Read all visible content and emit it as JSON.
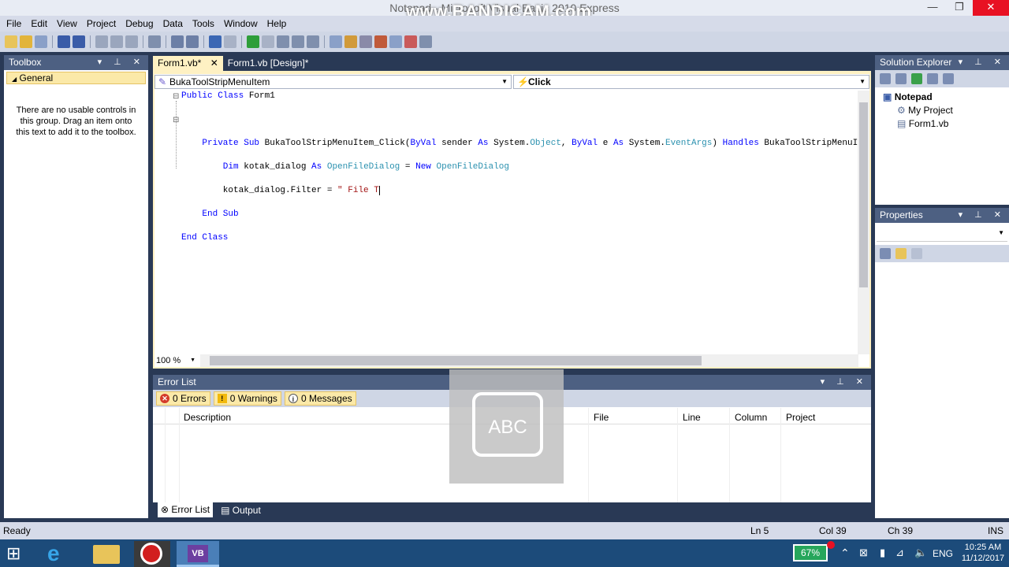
{
  "window": {
    "title": "Notepad - Microsoft Visual Basic 2010 Express",
    "watermark": "www.BANDICAM.com",
    "minimize": "—",
    "restore": "❐",
    "close": "✕"
  },
  "menu": [
    "File",
    "Edit",
    "View",
    "Project",
    "Debug",
    "Data",
    "Tools",
    "Window",
    "Help"
  ],
  "toolbox": {
    "title": "Toolbox",
    "group": "General",
    "empty_text": "There are no usable controls in this group. Drag an item onto this text to add it to the toolbox."
  },
  "editor": {
    "tabs": [
      "Form1.vb*",
      "Form1.vb [Design]*"
    ],
    "object_dropdown": "BukaToolStripMenuItem",
    "event_dropdown": "Click",
    "zoom": "100 %",
    "code": {
      "line1a": "Public Class",
      "line1b": " Form1",
      "line2a": "    Private Sub",
      "line2b": " BukaToolStripMenuItem_Click(",
      "line2c": "ByVal",
      "line2d": " sender ",
      "line2e": "As",
      "line2f": " System.",
      "line2g": "Object",
      "line2h": ", ",
      "line2i": "ByVal",
      "line2j": " e ",
      "line2k": "As",
      "line2l": " System.",
      "line2m": "EventArgs",
      "line2n": ") ",
      "line2o": "Handles",
      "line2p": " BukaToolStripMenuIt",
      "line3a": "        Dim",
      "line3b": " kotak_dialog ",
      "line3c": "As",
      "line3d": "OpenFileDialog",
      "line3e": " = ",
      "line3f": "New",
      "line3g": "OpenFileDialog",
      "line4a": "        kotak_dialog.Filter = ",
      "line4b": "\" File T",
      "line5": "    End Sub",
      "line6": "End Class"
    }
  },
  "error_list": {
    "title": "Error List",
    "errors": "0 Errors",
    "warnings": "0 Warnings",
    "messages": "0 Messages",
    "columns": [
      "Description",
      "File",
      "Line",
      "Column",
      "Project"
    ]
  },
  "bottom_tabs": [
    "Error List",
    "Output"
  ],
  "solution_explorer": {
    "title": "Solution Explorer",
    "project": "Notepad",
    "items": [
      "My Project",
      "Form1.vb"
    ]
  },
  "properties": {
    "title": "Properties"
  },
  "overlay": {
    "label": "ABC"
  },
  "status": {
    "ready": "Ready",
    "ln": "Ln 5",
    "col": "Col 39",
    "ch": "Ch 39",
    "mode": "INS"
  },
  "tray": {
    "battery": "67%",
    "lang": "ENG",
    "time": "10:25 AM",
    "date": "11/12/2017"
  },
  "colors": {
    "panel_head": "#4d6082",
    "active_tab": "#fef1c3",
    "background": "#293955",
    "taskbar": "#1c4b7a"
  }
}
